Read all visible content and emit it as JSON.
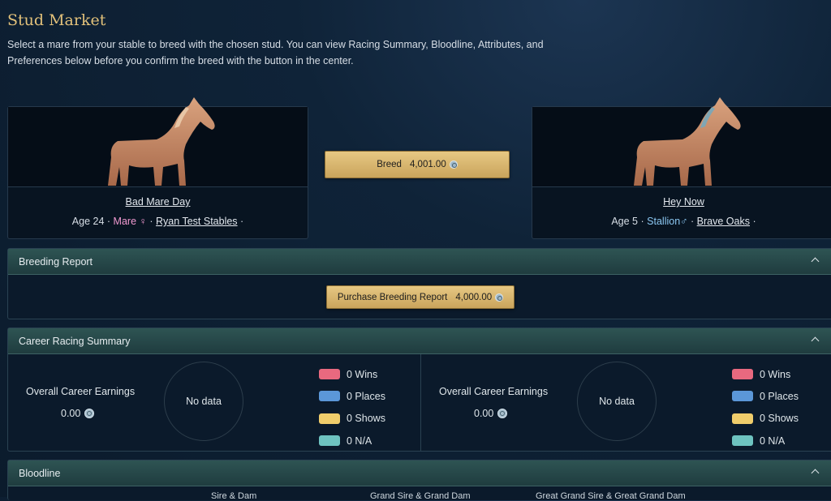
{
  "page": {
    "title": "Stud Market",
    "description": "Select a mare from your stable to breed with the chosen stud. You can view Racing Summary, Bloodline, Attributes, and Preferences below before you confirm the breed with the button in the center."
  },
  "mare": {
    "name": "Bad Mare Day",
    "age": "Age 24",
    "sex": "Mare",
    "sex_symbol": "♀",
    "stable": "Ryan Test Stables",
    "sep": "·"
  },
  "stud": {
    "name": "Hey Now",
    "age": "Age 5",
    "sex": "Stallion",
    "sex_symbol": "♂",
    "stable": "Brave Oaks",
    "sep": "·"
  },
  "breed_button": {
    "label": "Breed",
    "price": "4,001.00"
  },
  "breeding_report": {
    "header": "Breeding Report",
    "button_label": "Purchase Breeding Report",
    "price": "4,000.00"
  },
  "career": {
    "header": "Career Racing Summary",
    "left": {
      "earnings_label": "Overall Career Earnings",
      "earnings_value": "0.00",
      "chart_empty": "No data",
      "legend": [
        {
          "label": "0 Wins",
          "color": "#e8697f"
        },
        {
          "label": "0 Places",
          "color": "#5b97d8"
        },
        {
          "label": "0 Shows",
          "color": "#f0cd6b"
        },
        {
          "label": "0 N/A",
          "color": "#6ec3c0"
        }
      ]
    },
    "right": {
      "earnings_label": "Overall Career Earnings",
      "earnings_value": "0.00",
      "chart_empty": "No data",
      "legend": [
        {
          "label": "0 Wins",
          "color": "#e8697f"
        },
        {
          "label": "0 Places",
          "color": "#5b97d8"
        },
        {
          "label": "0 Shows",
          "color": "#f0cd6b"
        },
        {
          "label": "0 N/A",
          "color": "#6ec3c0"
        }
      ]
    }
  },
  "bloodline": {
    "header": "Bloodline",
    "columns": [
      "Sire & Dam",
      "Grand Sire & Grand Dam",
      "Great Grand Sire & Great Grand Dam"
    ]
  },
  "icons": {
    "coin": "coin-icon",
    "collapse": "chevron-up-icon"
  }
}
